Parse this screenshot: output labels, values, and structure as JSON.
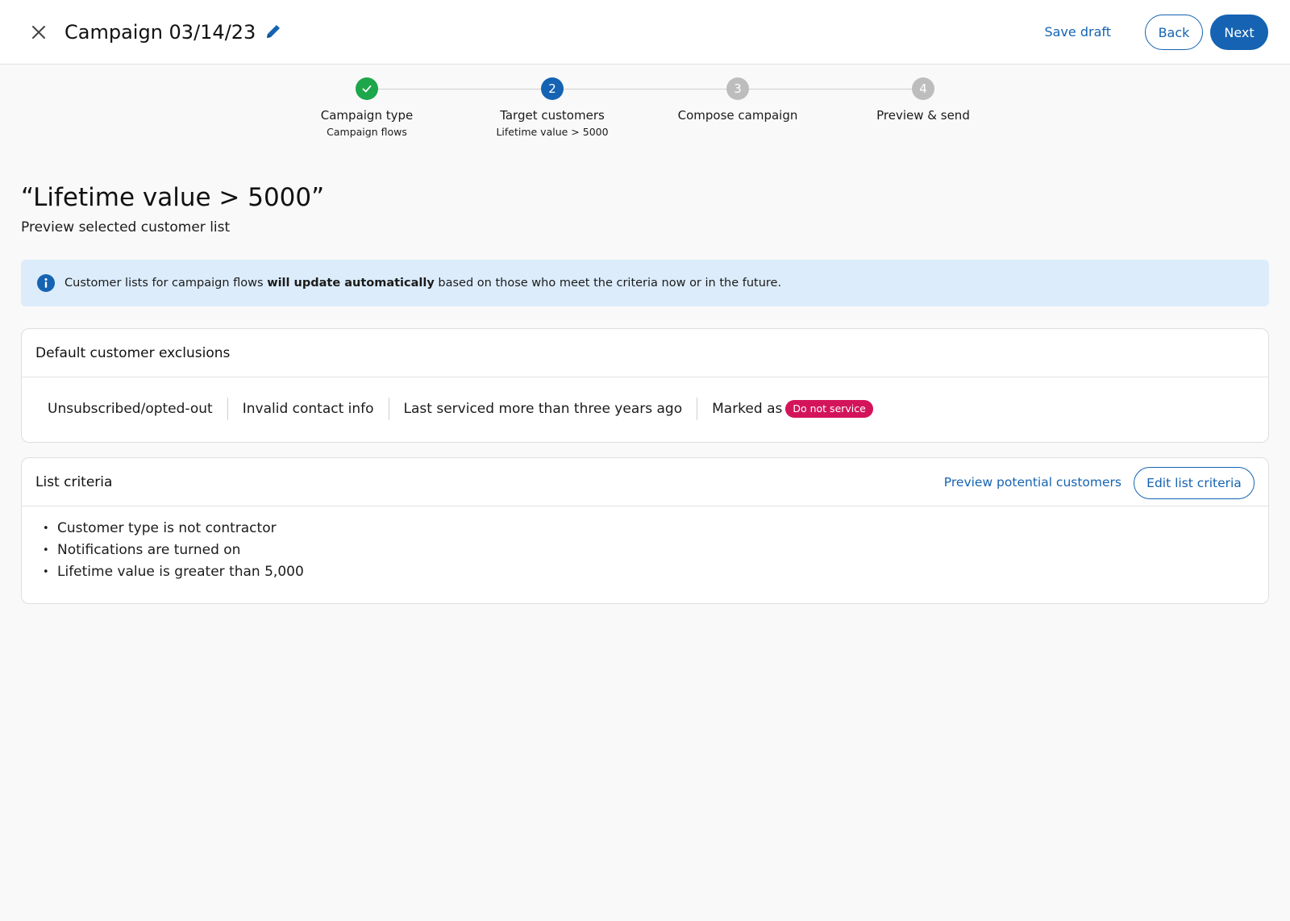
{
  "header": {
    "title": "Campaign 03/14/23",
    "save_draft_label": "Save draft",
    "back_label": "Back",
    "next_label": "Next",
    "icons": {
      "close": "close-icon",
      "edit": "pencil-icon"
    },
    "accent_color": "#1563b2"
  },
  "stepper": {
    "steps": [
      {
        "number": "",
        "label": "Campaign type",
        "sublabel": "Campaign flows",
        "status": "complete",
        "color": "#1ea64a"
      },
      {
        "number": "2",
        "label": "Target customers",
        "sublabel": "Lifetime value > 5000",
        "status": "current",
        "color": "#1563b2"
      },
      {
        "number": "3",
        "label": "Compose campaign",
        "sublabel": "",
        "status": "upcoming",
        "color": "#bdbdbd"
      },
      {
        "number": "4",
        "label": "Preview & send",
        "sublabel": "",
        "status": "upcoming",
        "color": "#bdbdbd"
      }
    ]
  },
  "main": {
    "heading": "“Lifetime value > 5000”",
    "subheading": "Preview selected customer list"
  },
  "info_banner": {
    "text_before": "Customer lists for campaign flows ",
    "text_bold": "will update automatically",
    "text_after": " based on those who meet the criteria now or in the future.",
    "icon": "info-icon"
  },
  "exclusions_card": {
    "title": "Default customer exclusions",
    "items": [
      "Unsubscribed/opted-out",
      "Invalid contact info",
      "Last serviced more than three years ago",
      "Marked as"
    ],
    "badge": "Do not service",
    "badge_color": "#d4145a"
  },
  "criteria_card": {
    "title": "List criteria",
    "preview_link": "Preview potential customers",
    "edit_button": "Edit list criteria",
    "items": [
      "Customer type is not contractor",
      "Notifications are turned on",
      "Lifetime value is greater than 5,000"
    ]
  }
}
